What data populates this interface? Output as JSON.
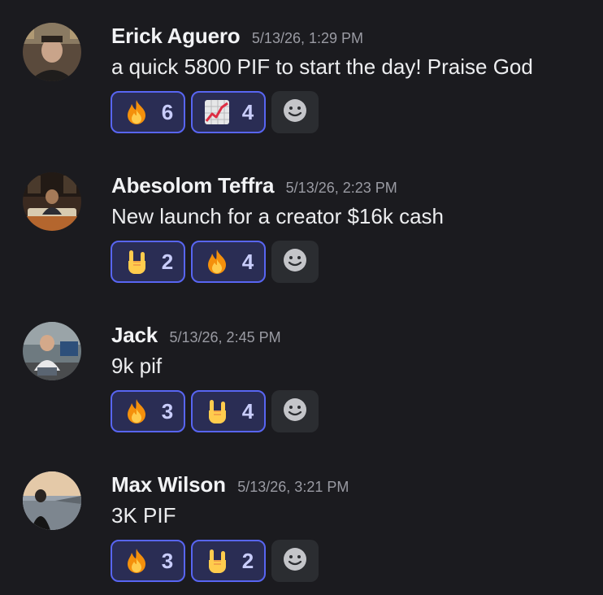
{
  "colors": {
    "background": "#1b1b1f",
    "reaction_bg": "#2a2d54",
    "reaction_border": "#5865f2",
    "reaction_count": "#c9cdfb",
    "timestamp": "#9a9ba3"
  },
  "messages": [
    {
      "username": "Erick Aguero",
      "timestamp": "5/13/26, 1:29 PM",
      "content": "a quick 5800 PIF to start the day! Praise God",
      "avatar": "avatar-photo",
      "reactions": [
        {
          "emoji": "fire-emoji",
          "count": "6"
        },
        {
          "emoji": "chart-increasing-emoji",
          "count": "4"
        }
      ]
    },
    {
      "username": "Abesolom Teffra",
      "timestamp": "5/13/26, 2:23 PM",
      "content": "New launch for a creator $16k cash",
      "avatar": "avatar-photo",
      "reactions": [
        {
          "emoji": "sign-of-horns-emoji",
          "count": "2"
        },
        {
          "emoji": "fire-emoji",
          "count": "4"
        }
      ]
    },
    {
      "username": "Jack",
      "timestamp": "5/13/26, 2:45 PM",
      "content": "9k pif",
      "avatar": "avatar-photo",
      "reactions": [
        {
          "emoji": "fire-emoji",
          "count": "3"
        },
        {
          "emoji": "sign-of-horns-emoji",
          "count": "4"
        }
      ]
    },
    {
      "username": "Max Wilson",
      "timestamp": "5/13/26, 3:21 PM",
      "content": "3K PIF",
      "avatar": "avatar-photo",
      "reactions": [
        {
          "emoji": "fire-emoji",
          "count": "3"
        },
        {
          "emoji": "sign-of-horns-emoji",
          "count": "2"
        }
      ]
    }
  ],
  "add_reaction_icon": "smiley-add-reaction-icon"
}
